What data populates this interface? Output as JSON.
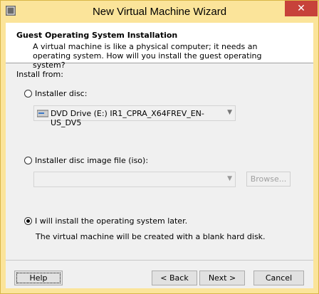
{
  "window": {
    "title": "New Virtual Machine Wizard",
    "close_glyph": "✕"
  },
  "header": {
    "title": "Guest Operating System Installation",
    "description": "A virtual machine is like a physical computer; it needs an operating system. How will you install the guest operating system?"
  },
  "install_from": {
    "label": "Install from:",
    "options": [
      {
        "label": "Installer disc:",
        "checked": false
      },
      {
        "label": "Installer disc image file (iso):",
        "checked": false
      },
      {
        "label": "I will install the operating system later.",
        "checked": true
      }
    ],
    "disc_drive": "DVD Drive (E:) IR1_CPRA_X64FREV_EN-US_DV5",
    "iso_path": "",
    "browse_label": "Browse...",
    "later_info": "The virtual machine will be created with a blank hard disk."
  },
  "footer": {
    "help": "Help",
    "back": "< Back",
    "next": "Next >",
    "cancel": "Cancel"
  },
  "colors": {
    "title_bar": "#fbe49a",
    "close_button": "#c7423a",
    "dialog_body": "#f0f0f0"
  },
  "icons": {
    "app": "vmware-icon",
    "drive": "dvd-drive-icon",
    "dropdown": "chevron-down-icon"
  }
}
